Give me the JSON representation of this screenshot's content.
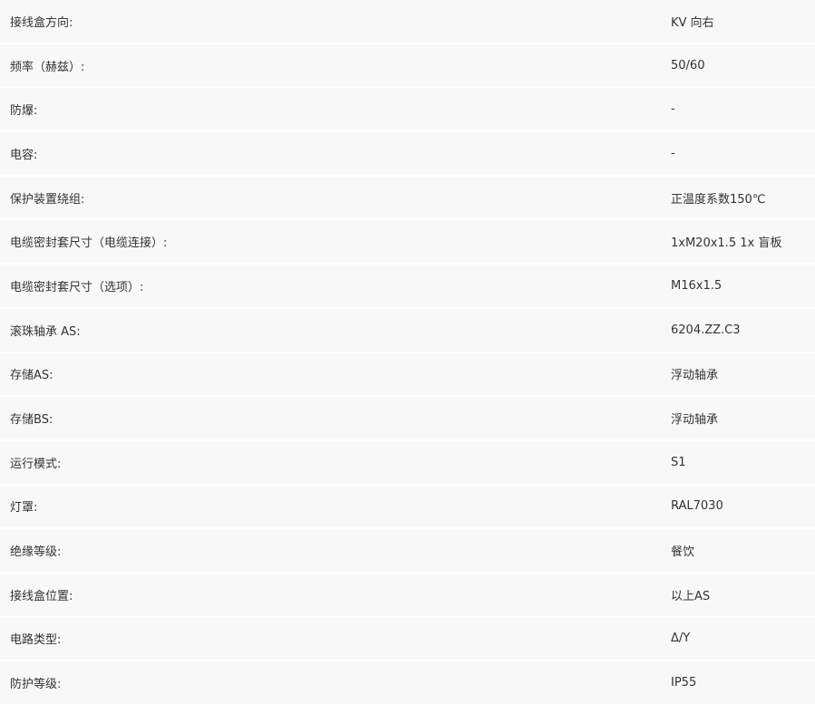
{
  "specs": [
    {
      "label": "接线盒方向:",
      "value": "KV 向右"
    },
    {
      "label": "频率（赫兹）:",
      "value": "50/60"
    },
    {
      "label": "防爆:",
      "value": "-"
    },
    {
      "label": "电容:",
      "value": "-"
    },
    {
      "label": "保护装置绕组:",
      "value": "正温度系数150℃"
    },
    {
      "label": "电缆密封套尺寸（电缆连接）:",
      "value": "1xM20x1.5 1x 盲板"
    },
    {
      "label": "电缆密封套尺寸（选项）:",
      "value": "M16x1.5"
    },
    {
      "label": "滚珠轴承 AS:",
      "value": "6204.ZZ.C3"
    },
    {
      "label": "存储AS:",
      "value": "浮动轴承"
    },
    {
      "label": "存储BS:",
      "value": "浮动轴承"
    },
    {
      "label": "运行模式:",
      "value": "S1"
    },
    {
      "label": "灯罩:",
      "value": "RAL7030"
    },
    {
      "label": "绝缘等级:",
      "value": "餐饮"
    },
    {
      "label": "接线盒位置:",
      "value": "以上AS"
    },
    {
      "label": "电路类型:",
      "value": "Δ/Y"
    },
    {
      "label": "防护等级:",
      "value": "IP55"
    }
  ]
}
